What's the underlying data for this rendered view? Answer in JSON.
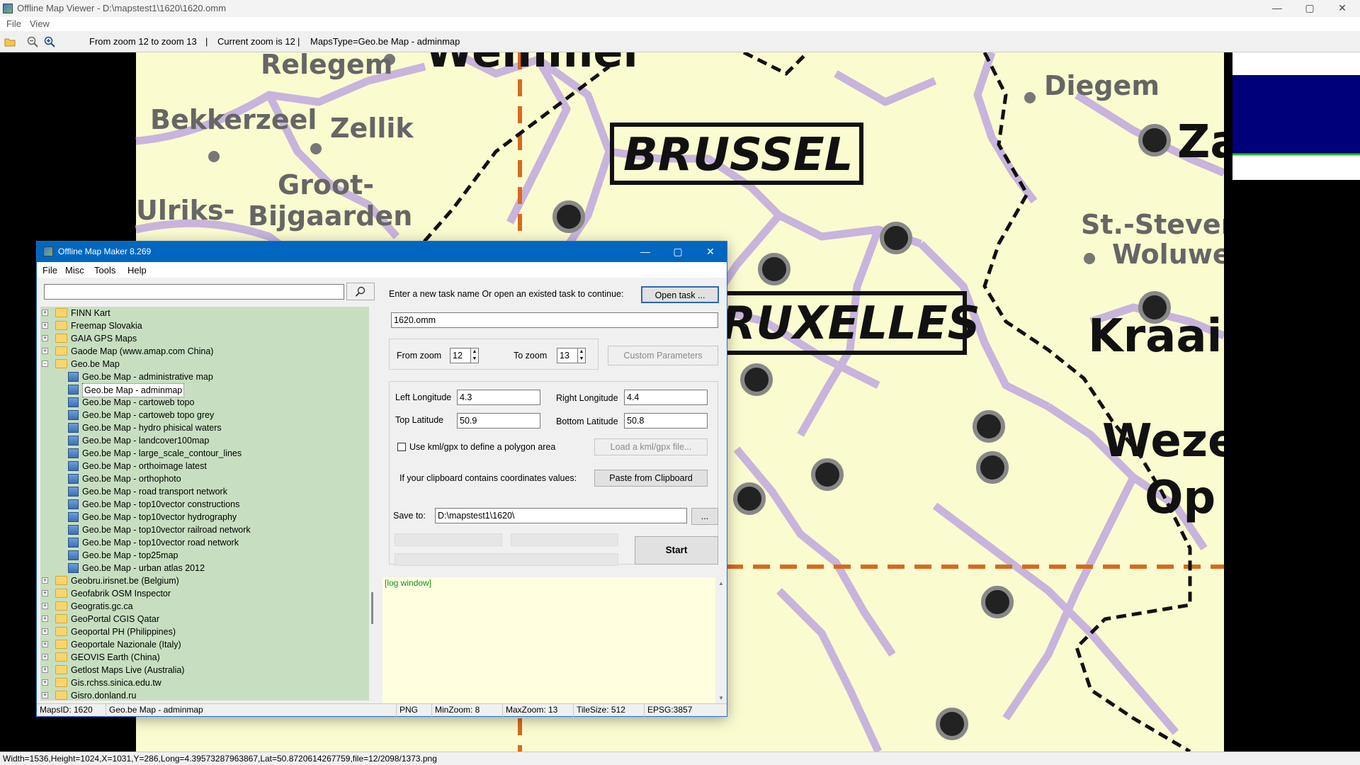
{
  "main_window": {
    "title": "Offline Map Viewer - D:\\mapstest1\\1620\\1620.omm",
    "controls": {
      "minimize": "—",
      "maximize": "▢",
      "close": "✕"
    },
    "menu": [
      "File",
      "View"
    ],
    "toolbar": {
      "icons": [
        "open-folder-icon",
        "zoom-out-icon",
        "zoom-in-icon"
      ],
      "zoom_range": "From zoom 12 to zoom 13",
      "sep1": "|",
      "current_zoom": "Current zoom is 12",
      "sep2": "|",
      "maps_type": "MapsType=Geo.be Map - adminmap"
    },
    "status": "Width=1536,Height=1024,X=1031,Y=286,Long=4.39573287963867,Lat=50.8720614267759,file=12/2098/1373.png"
  },
  "map": {
    "labels": {
      "relegem": "Relegem",
      "wemmel": "Wemmel",
      "bekkerzeel": "Bekkerzeel",
      "zellik": "Zellik",
      "groot_bijgaarden_1": "Groot-",
      "groot_bijgaarden_2": "Bijgaarden",
      "ulriks": "Ulriks-",
      "diegem": "Diegem",
      "za": "Za",
      "brussel": "BRUSSEL",
      "bruxelles": "RUXELLES",
      "st_stevens_1": "St.-Stevens",
      "st_stevens_2": "Woluwe",
      "kraainem": "Kraain",
      "weze": "Weze",
      "op": "Op"
    },
    "colors": {
      "land": "#fbfbd0",
      "boundary": "#c8b4dc",
      "region_border": "#d86a1e",
      "road": "#000000"
    }
  },
  "dialog": {
    "title": "Offline Map Maker 8.269",
    "controls": {
      "minimize": "—",
      "maximize": "▢",
      "close": "✕"
    },
    "menu": [
      "File",
      "Misc",
      "Tools",
      "Help"
    ],
    "search_placeholder": "",
    "search_button_icon": "search-icon",
    "tree": [
      {
        "label": "FINN Kart",
        "type": "folder",
        "expanded": false
      },
      {
        "label": "Freemap Slovakia",
        "type": "folder",
        "expanded": false
      },
      {
        "label": "GAIA GPS Maps",
        "type": "folder",
        "expanded": false
      },
      {
        "label": "Gaode Map (www.amap.com China)",
        "type": "folder",
        "expanded": false
      },
      {
        "label": "Geo.be Map",
        "type": "folder",
        "expanded": true
      },
      {
        "label": "Geo.be Map - administrative map",
        "type": "map"
      },
      {
        "label": "Geo.be Map - adminmap",
        "type": "map",
        "selected": true
      },
      {
        "label": "Geo.be Map - cartoweb topo",
        "type": "map"
      },
      {
        "label": "Geo.be Map - cartoweb topo grey",
        "type": "map"
      },
      {
        "label": "Geo.be Map - hydro phisical waters",
        "type": "map"
      },
      {
        "label": "Geo.be Map - landcover100map",
        "type": "map"
      },
      {
        "label": "Geo.be Map - large_scale_contour_lines",
        "type": "map"
      },
      {
        "label": "Geo.be Map - orthoimage latest",
        "type": "map"
      },
      {
        "label": "Geo.be Map - orthophoto",
        "type": "map"
      },
      {
        "label": "Geo.be Map - road transport network",
        "type": "map"
      },
      {
        "label": "Geo.be Map - top10vector constructions",
        "type": "map"
      },
      {
        "label": "Geo.be Map - top10vector hydrography",
        "type": "map"
      },
      {
        "label": "Geo.be Map - top10vector railroad network",
        "type": "map"
      },
      {
        "label": "Geo.be Map - top10vector road network",
        "type": "map"
      },
      {
        "label": "Geo.be Map - top25map",
        "type": "map"
      },
      {
        "label": "Geo.be Map - urban atlas 2012",
        "type": "map"
      },
      {
        "label": "Geobru.irisnet.be (Belgium)",
        "type": "folder",
        "expanded": false
      },
      {
        "label": "Geofabrik OSM Inspector",
        "type": "folder",
        "expanded": false
      },
      {
        "label": "Geogratis.gc.ca",
        "type": "folder",
        "expanded": false
      },
      {
        "label": "GeoPortal CGIS Qatar",
        "type": "folder",
        "expanded": false
      },
      {
        "label": "Geoportal PH (Philippines)",
        "type": "folder",
        "expanded": false
      },
      {
        "label": "Geoportale Nazionale (Italy)",
        "type": "folder",
        "expanded": false
      },
      {
        "label": "GEOVIS Earth (China)",
        "type": "folder",
        "expanded": false
      },
      {
        "label": "Getlost Maps Live (Australia)",
        "type": "folder",
        "expanded": false
      },
      {
        "label": "Gis.rchss.sinica.edu.tw",
        "type": "folder",
        "expanded": false
      },
      {
        "label": "Gisro.donland.ru",
        "type": "folder",
        "expanded": false
      }
    ],
    "task_prompt": "Enter a new task name Or open an existed task to continue:",
    "open_task_button": "Open task ...",
    "task_name": "1620.omm",
    "from_zoom_label": "From zoom",
    "from_zoom": "12",
    "to_zoom_label": "To zoom",
    "to_zoom": "13",
    "custom_params_button": "Custom Parameters",
    "left_lon_label": "Left Longitude",
    "left_lon": "4.3",
    "right_lon_label": "Right Longitude",
    "right_lon": "4.4",
    "top_lat_label": "Top Latitude",
    "top_lat": "50.9",
    "bottom_lat_label": "Bottom Latitude",
    "bottom_lat": "50.8",
    "kml_checkbox_label": "Use kml/gpx to define a polygon area",
    "kml_checked": false,
    "load_kml_button": "Load a kml/gpx file...",
    "clipboard_label": "If your clipboard contains coordinates values:",
    "paste_button": "Paste from Clipboard",
    "save_to_label": "Save to:",
    "save_to": "D:\\mapstest1\\1620\\",
    "browse_button": "...",
    "start_button": "Start",
    "log_text": "[log window]",
    "status": {
      "maps_id": "MapsID: 1620",
      "map_name": "Geo.be Map - adminmap",
      "format": "PNG",
      "min_zoom": "MinZoom: 8",
      "max_zoom": "MaxZoom: 13",
      "tile_size": "TileSize: 512",
      "epsg": "EPSG:3857"
    }
  }
}
